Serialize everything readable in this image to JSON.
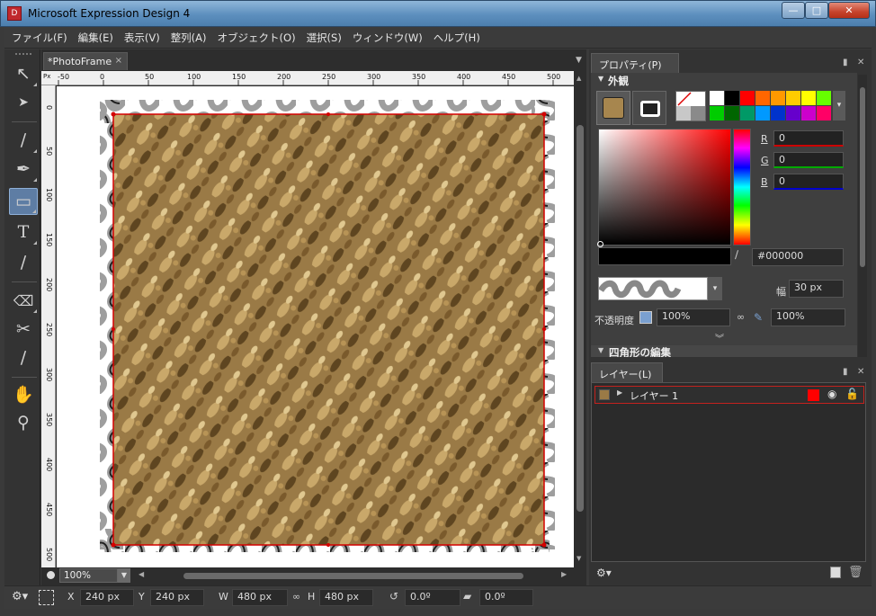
{
  "window": {
    "title": "Microsoft Expression Design 4",
    "app_icon_label": "D",
    "buttons": {
      "minimize": "—",
      "maximize": "□",
      "close": "✕"
    }
  },
  "menu": [
    "ファイル(F)",
    "編集(E)",
    "表示(V)",
    "整列(A)",
    "オブジェクト(O)",
    "選択(S)",
    "ウィンドウ(W)",
    "ヘルプ(H)"
  ],
  "tools": [
    {
      "name": "selection-arrow-icon",
      "glyph": "↖"
    },
    {
      "name": "direct-selection-icon",
      "glyph": "➤"
    },
    {
      "name": "brush-icon",
      "glyph": "∕"
    },
    {
      "name": "pen-icon",
      "glyph": "✒"
    },
    {
      "name": "rectangle-icon",
      "glyph": "▭"
    },
    {
      "name": "text-icon",
      "glyph": "T"
    },
    {
      "name": "gradient-icon",
      "glyph": "∕"
    },
    {
      "name": "eraser-icon",
      "glyph": "⌫"
    },
    {
      "name": "scissors-icon",
      "glyph": "✂"
    },
    {
      "name": "eyedropper-icon",
      "glyph": "∕"
    },
    {
      "name": "hand-icon",
      "glyph": "✋"
    },
    {
      "name": "zoom-icon",
      "glyph": "⚲"
    }
  ],
  "document": {
    "tab_title": "*PhotoFrame",
    "tab_close": "×",
    "ruler_unit": "Px",
    "ruler_h_labels": [
      "-50",
      "0",
      "50",
      "100",
      "150",
      "200",
      "250",
      "300",
      "350",
      "400",
      "450",
      "500"
    ],
    "ruler_v_labels": [
      "0",
      "50",
      "100",
      "150",
      "200",
      "250",
      "300",
      "350",
      "400",
      "450",
      "500"
    ],
    "zoom": "100%"
  },
  "properties": {
    "tab_title": "プロパティ(P)",
    "appearance_header": "外観",
    "palette_colors": [
      "#ffffff",
      "#000000",
      "#ff0000",
      "#ff6600",
      "#ff9900",
      "#ffcc00",
      "#ffff00",
      "#66ff00",
      "#00cc00",
      "#006600",
      "#009966",
      "#0099ff",
      "#0033cc",
      "#6600cc",
      "#cc00cc",
      "#ff0066"
    ],
    "r_label": "R",
    "r_value": "0",
    "g_label": "G",
    "g_value": "0",
    "b_label": "B",
    "b_value": "0",
    "hex": "#000000",
    "width_label": "幅",
    "width_value": "30 px",
    "opacity_label": "不透明度",
    "opacity_value": "100%",
    "opacity_value2": "100%",
    "next_section": "四角形の編集"
  },
  "layers": {
    "tab_title": "レイヤー(L)",
    "items": [
      {
        "name": "レイヤー 1",
        "color": "#ff0000"
      }
    ]
  },
  "status": {
    "x_label": "X",
    "x_value": "240 px",
    "y_label": "Y",
    "y_value": "240 px",
    "w_label": "W",
    "w_value": "480 px",
    "h_label": "H",
    "h_value": "480 px",
    "rotation": "0.0º",
    "skew": "0.0º"
  },
  "colors": {
    "accent": "#5e7da4",
    "selection": "#d40000",
    "panel": "#333333"
  }
}
